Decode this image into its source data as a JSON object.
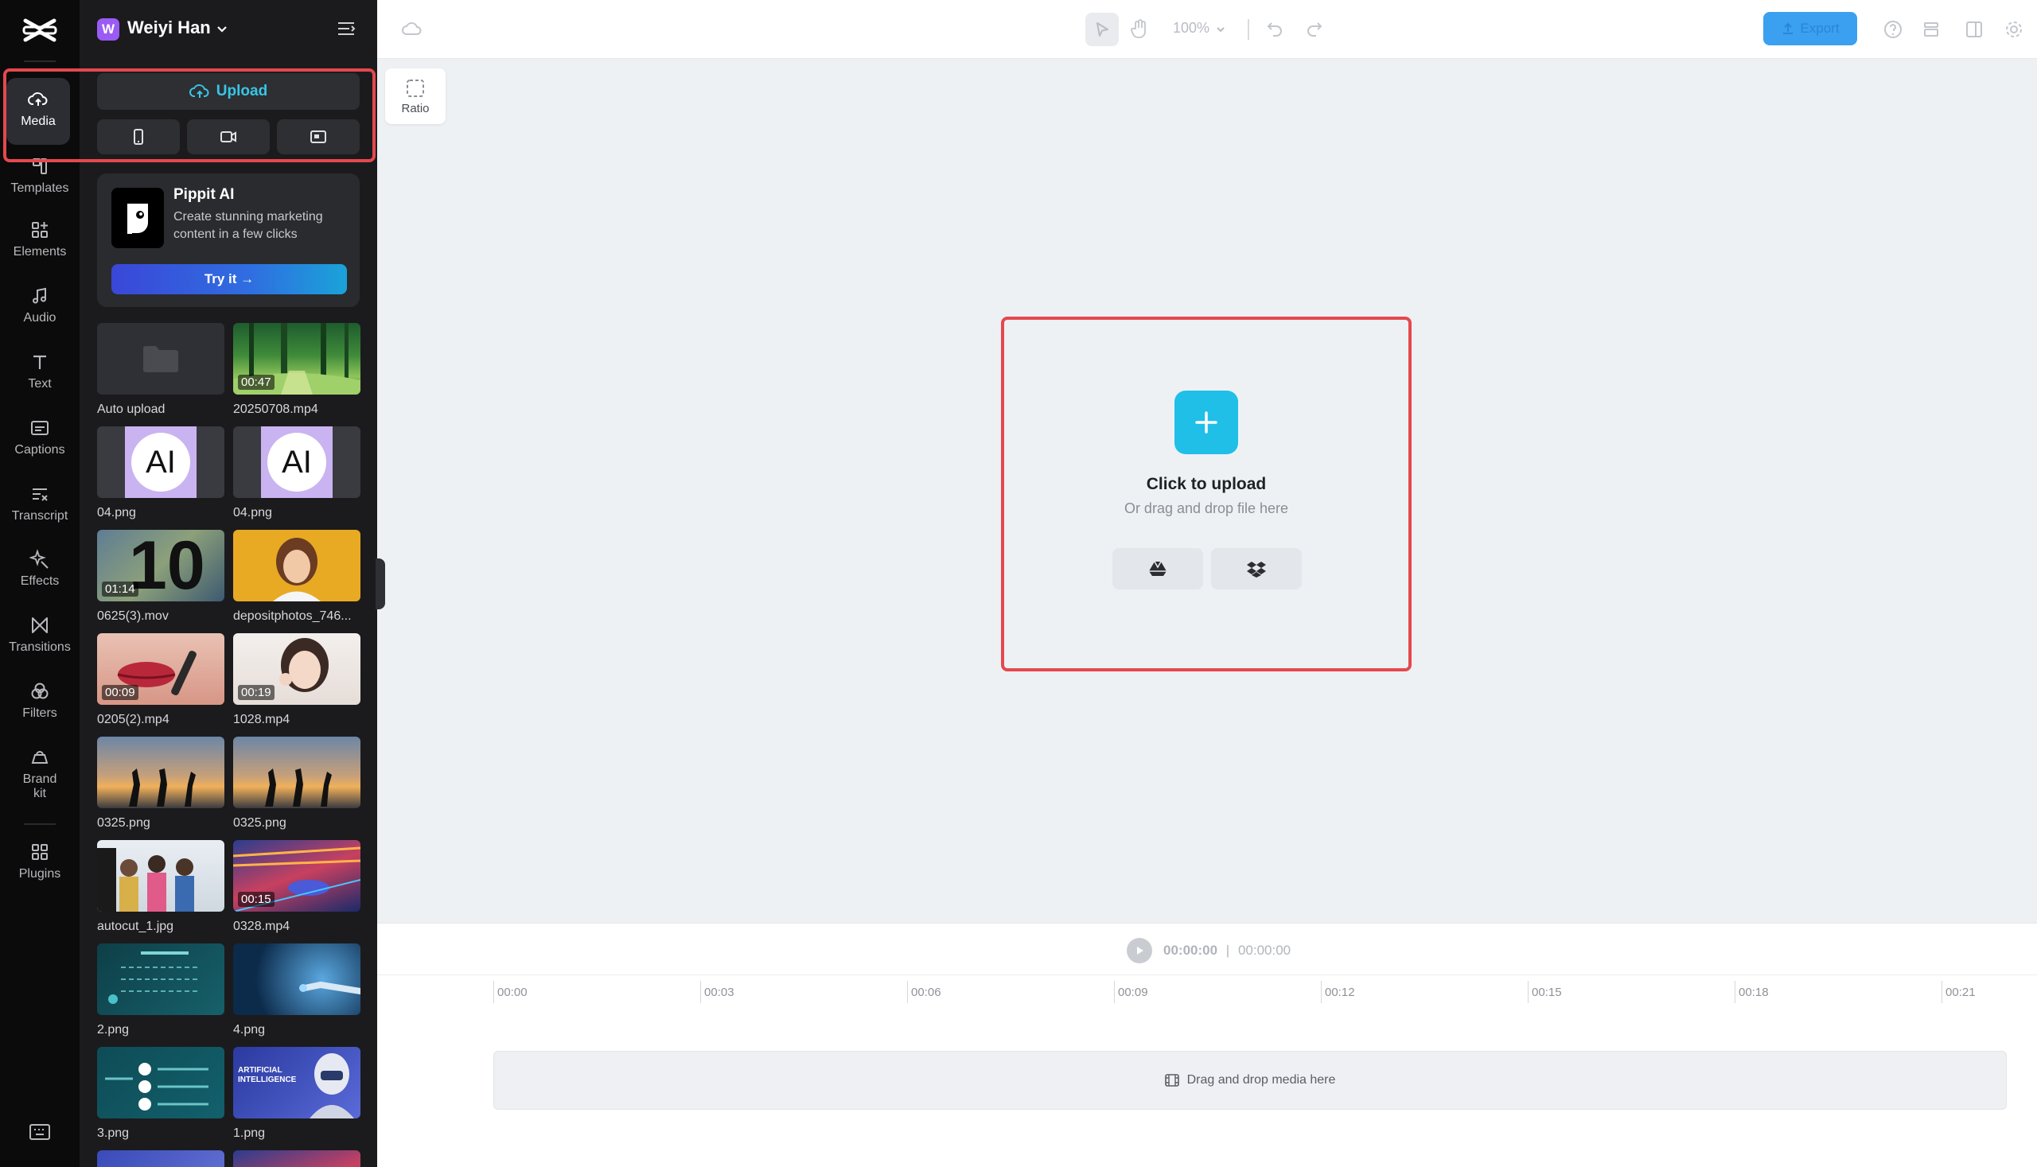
{
  "workspace": {
    "initial": "W",
    "name": "Weiyi Han"
  },
  "rail": {
    "items": [
      {
        "label": "Media"
      },
      {
        "label": "Templates"
      },
      {
        "label": "Elements"
      },
      {
        "label": "Audio"
      },
      {
        "label": "Text"
      },
      {
        "label": "Captions"
      },
      {
        "label": "Transcript"
      },
      {
        "label": "Effects"
      },
      {
        "label": "Transitions"
      },
      {
        "label": "Filters"
      },
      {
        "label": "Brand kit"
      },
      {
        "label": "Plugins"
      }
    ]
  },
  "panel": {
    "upload_label": "Upload",
    "promo": {
      "title": "Pippit AI",
      "description": "Create stunning marketing content in a few clicks",
      "button": "Try it →"
    },
    "media": [
      {
        "name": "Auto upload",
        "duration": ""
      },
      {
        "name": "20250708.mp4",
        "duration": "00:47"
      },
      {
        "name": "04.png",
        "duration": ""
      },
      {
        "name": "04.png",
        "duration": ""
      },
      {
        "name": "0625(3).mov",
        "duration": "01:14"
      },
      {
        "name": "depositphotos_746...",
        "duration": ""
      },
      {
        "name": "0205(2).mp4",
        "duration": "00:09"
      },
      {
        "name": "1028.mp4",
        "duration": "00:19"
      },
      {
        "name": "0325.png",
        "duration": ""
      },
      {
        "name": "0325.png",
        "duration": ""
      },
      {
        "name": "autocut_1.jpg",
        "duration": ""
      },
      {
        "name": "0328.mp4",
        "duration": "00:15"
      },
      {
        "name": "2.png",
        "duration": ""
      },
      {
        "name": "4.png",
        "duration": ""
      },
      {
        "name": "3.png",
        "duration": ""
      },
      {
        "name": "1.png",
        "duration": ""
      }
    ],
    "thumb_texts": {
      "ai_badge": "AI",
      "ten": "10",
      "artificial": "ARTIFICIAL INTELLIGENCE"
    }
  },
  "topbar": {
    "zoom": "100%",
    "export_label": "Export"
  },
  "ratio_label": "Ratio",
  "canvas": {
    "title": "Click to upload",
    "subtitle": "Or drag and drop file here"
  },
  "timeline": {
    "current_time": "00:00:00",
    "separator": "|",
    "total_time": "00:00:00",
    "ticks": [
      "00:00",
      "00:03",
      "00:06",
      "00:09",
      "00:12",
      "00:15",
      "00:18",
      "00:21"
    ],
    "drop_label": "Drag and drop media here"
  },
  "colors": {
    "accent": "#1fbfe8",
    "highlight": "#e5484d",
    "export": "#3aa0ef"
  }
}
